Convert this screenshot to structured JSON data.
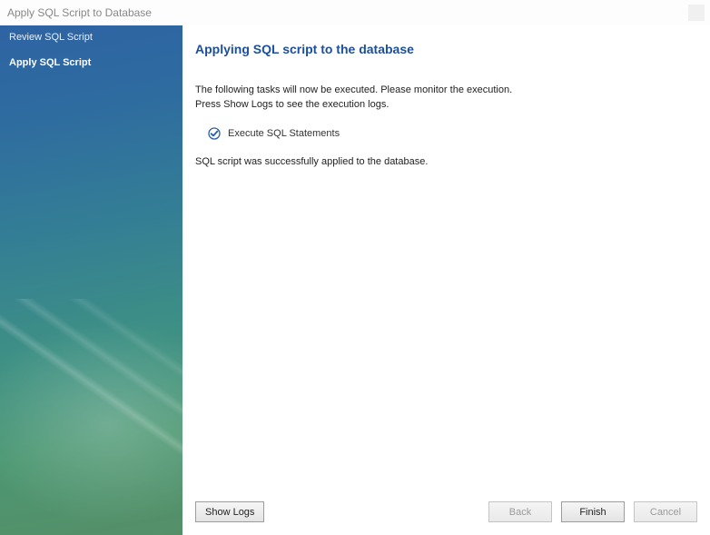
{
  "window": {
    "title": "Apply SQL Script to Database"
  },
  "sidebar": {
    "items": [
      {
        "label": "Review SQL Script"
      },
      {
        "label": "Apply SQL Script"
      }
    ]
  },
  "main": {
    "heading": "Applying SQL script to the database",
    "intro_line1": "The following tasks will now be executed. Please monitor the execution.",
    "intro_line2": "Press Show Logs to see the execution logs.",
    "task_label": "Execute SQL Statements",
    "status": "SQL script was successfully applied to the database."
  },
  "buttons": {
    "show_logs": "Show Logs",
    "back": "Back",
    "finish": "Finish",
    "cancel": "Cancel"
  }
}
